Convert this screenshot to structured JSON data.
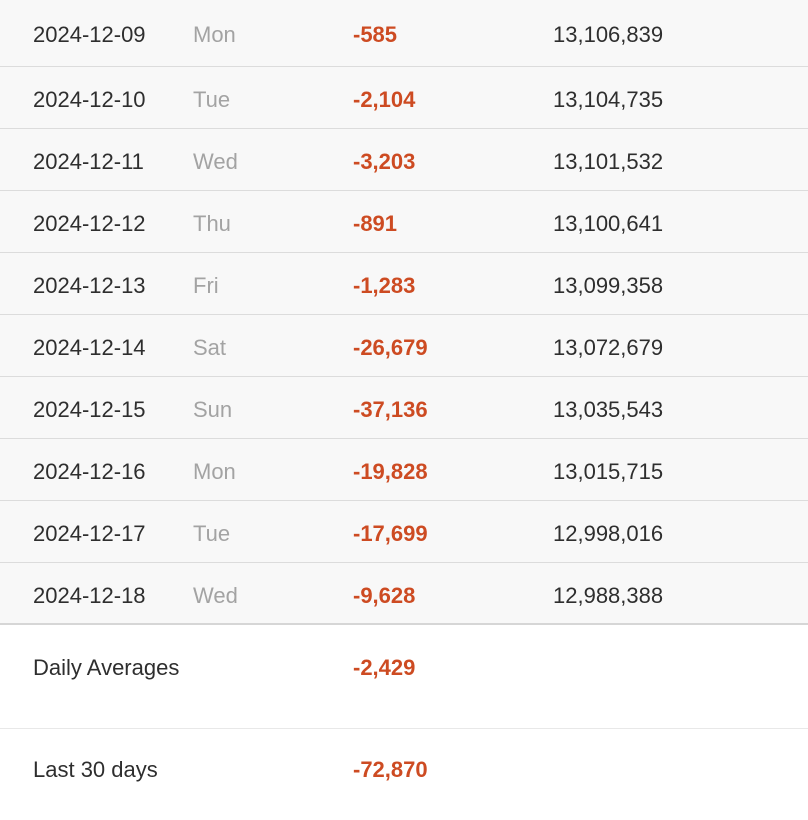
{
  "rows": [
    {
      "date": "2024-12-09",
      "day": "Mon",
      "change": "-585",
      "total": "13,106,839"
    },
    {
      "date": "2024-12-10",
      "day": "Tue",
      "change": "-2,104",
      "total": "13,104,735"
    },
    {
      "date": "2024-12-11",
      "day": "Wed",
      "change": "-3,203",
      "total": "13,101,532"
    },
    {
      "date": "2024-12-12",
      "day": "Thu",
      "change": "-891",
      "total": "13,100,641"
    },
    {
      "date": "2024-12-13",
      "day": "Fri",
      "change": "-1,283",
      "total": "13,099,358"
    },
    {
      "date": "2024-12-14",
      "day": "Sat",
      "change": "-26,679",
      "total": "13,072,679"
    },
    {
      "date": "2024-12-15",
      "day": "Sun",
      "change": "-37,136",
      "total": "13,035,543"
    },
    {
      "date": "2024-12-16",
      "day": "Mon",
      "change": "-19,828",
      "total": "13,015,715"
    },
    {
      "date": "2024-12-17",
      "day": "Tue",
      "change": "-17,699",
      "total": "12,998,016"
    },
    {
      "date": "2024-12-18",
      "day": "Wed",
      "change": "-9,628",
      "total": "12,988,388"
    }
  ],
  "summary": {
    "daily_averages": {
      "label": "Daily Averages",
      "value": "-2,429"
    },
    "last_30_days": {
      "label": "Last 30 days",
      "value": "-72,870"
    }
  },
  "colors": {
    "negative": "#cd4b22",
    "row_background": "#f8f8f8",
    "muted_text": "#a3a3a3"
  }
}
